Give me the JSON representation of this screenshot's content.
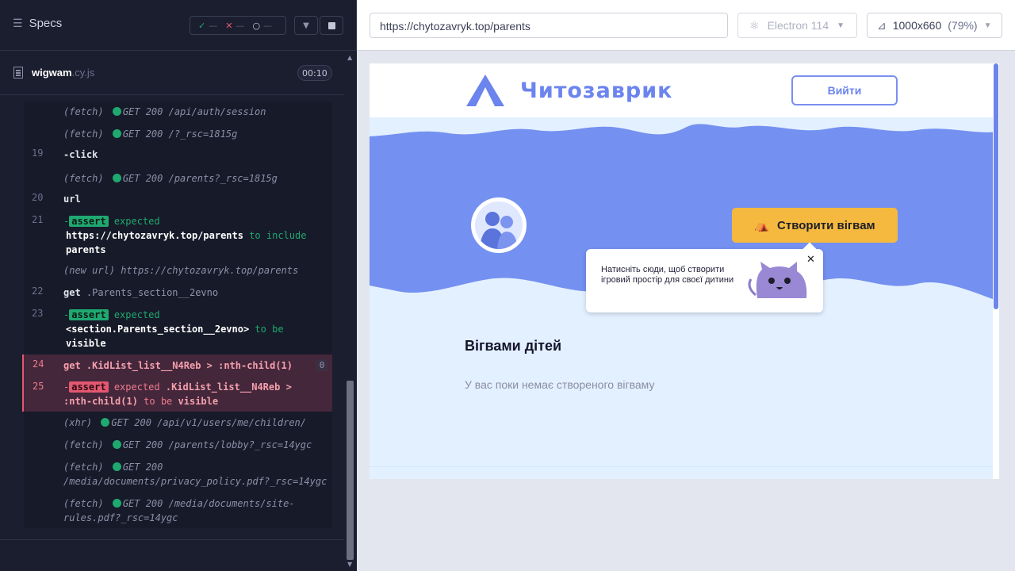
{
  "runner": {
    "specs_label": "Specs",
    "stats": {
      "passed": "—",
      "failed": "—",
      "pending": "—"
    },
    "file": {
      "name": "wigwam",
      "ext": ".cy.js",
      "duration": "00:10"
    },
    "log": [
      {
        "num": "",
        "kind": "(fetch)",
        "text": "GET 200 /api/auth/session"
      },
      {
        "num": "",
        "kind": "(fetch)",
        "text": "GET 200 /?_rsc=1815g"
      },
      {
        "num": "19",
        "cmd": "-click"
      },
      {
        "num": "",
        "kind": "(fetch)",
        "text": "GET 200 /parents?_rsc=1815g"
      },
      {
        "num": "20",
        "cmd": "url"
      },
      {
        "num": "21",
        "assert": "assert",
        "expected": "expected",
        "value": "https://chytozavryk.top/parents",
        "op": "to include",
        "target": "parents"
      },
      {
        "num": "",
        "kind": "(new url)",
        "text": "https://chytozavryk.top/parents"
      },
      {
        "num": "22",
        "cmd": "get",
        "arg": ".Parents_section__2evno"
      },
      {
        "num": "23",
        "assert": "assert",
        "expected": "expected",
        "value": "<section.Parents_section__2evno>",
        "op": "to be",
        "target": "visible"
      },
      {
        "num": "24",
        "cmd": "get",
        "arg": ".KidList_list__N4Reb > :nth-child(1)",
        "count": "0"
      },
      {
        "num": "25",
        "assert": "assert",
        "expected": "expected",
        "value1": ".KidList_list__N4Reb >",
        "value2": ":nth-child(1)",
        "op": "to be",
        "target": "visible"
      },
      {
        "num": "",
        "kind": "(xhr)",
        "text": "GET 200 /api/v1/users/me/children/"
      },
      {
        "num": "",
        "kind": "(fetch)",
        "text": "GET 200 /parents/lobby?_rsc=14ygc"
      },
      {
        "num": "",
        "kind": "(fetch)",
        "text": "GET 200",
        "text2": "/media/documents/privacy_policy.pdf?_rsc=14ygc"
      },
      {
        "num": "",
        "kind": "(fetch)",
        "text": "GET 200 /media/documents/site-",
        "text2": "rules.pdf?_rsc=14ygc"
      }
    ]
  },
  "browser": {
    "url": "https://chytozavryk.top/parents",
    "engine": "Electron 114",
    "viewport": "1000x660",
    "zoom": "(79%)"
  },
  "app": {
    "brand": "Читозаврик",
    "login_label": "Вийти",
    "cta_label": "Створити вігвам",
    "tooltip": "Натисніть сюди, щоб створити ігровий простір для своєї дитини",
    "section_title": "Вігвами дітей",
    "empty_text": "У вас поки немає створеного вігваму"
  },
  "colors": {
    "accent": "#6c84ee",
    "cta": "#f4b93e",
    "pass": "#1fa971",
    "fail": "#e45770"
  }
}
